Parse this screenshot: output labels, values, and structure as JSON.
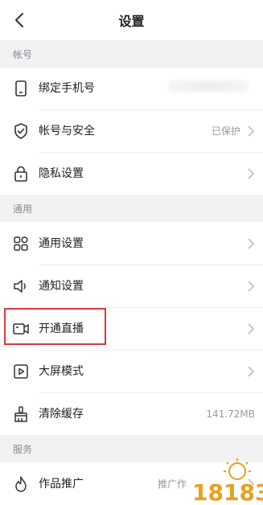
{
  "header": {
    "title": "设置",
    "back_icon": "back-arrow-icon"
  },
  "sections": {
    "account": "帐号",
    "general": "通用",
    "service": "服务"
  },
  "items": {
    "bind_phone": {
      "label": "绑定手机号",
      "icon": "phone-icon"
    },
    "account_security": {
      "label": "帐号与安全",
      "value": "已保护",
      "icon": "shield-icon"
    },
    "privacy": {
      "label": "隐私设置",
      "icon": "lock-icon"
    },
    "general_settings": {
      "label": "通用设置",
      "icon": "grid-icon"
    },
    "notification": {
      "label": "通知设置",
      "icon": "speaker-icon"
    },
    "live": {
      "label": "开通直播",
      "icon": "camera-icon"
    },
    "big_screen": {
      "label": "大屏模式",
      "icon": "play-icon"
    },
    "clear_cache": {
      "label": "清除缓存",
      "value": "141.72MB",
      "icon": "broom-icon"
    },
    "promotion": {
      "label": "作品推广",
      "value": "推广作",
      "icon": "flame-icon"
    }
  },
  "watermark": {
    "text": "18183"
  },
  "colors": {
    "highlight": "#d8393a",
    "section_bg": "#f2f2f4",
    "watermark": "#e8a020"
  }
}
